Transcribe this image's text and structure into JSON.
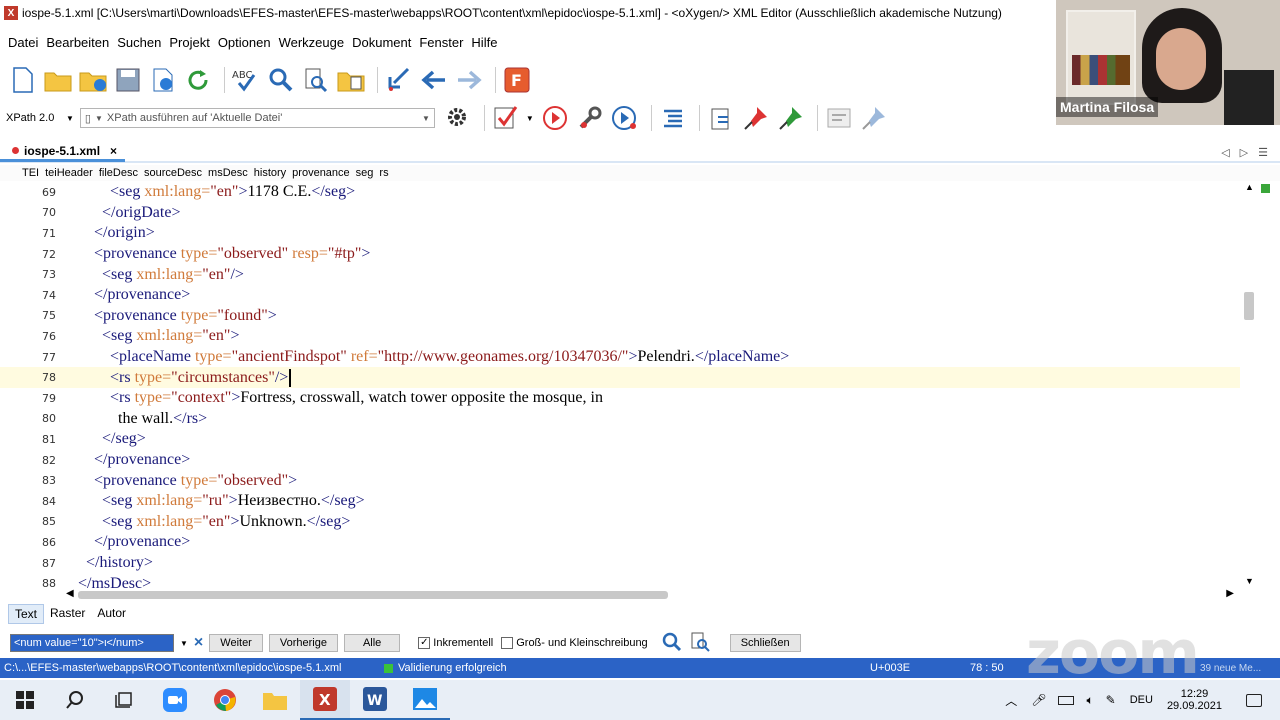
{
  "window": {
    "title": "iospe-5.1.xml [C:\\Users\\marti\\Downloads\\EFES-master\\EFES-master\\webapps\\ROOT\\content\\xml\\epidoc\\iospe-5.1.xml] - <oXygen/> XML Editor (Ausschließlich akademische Nutzung)"
  },
  "menu": [
    "Datei",
    "Bearbeiten",
    "Suchen",
    "Projekt",
    "Optionen",
    "Werkzeuge",
    "Dokument",
    "Fenster",
    "Hilfe"
  ],
  "toolbar2": {
    "xpath_version": "XPath 2.0",
    "xpath_placeholder": "XPath ausführen auf 'Aktuelle Datei'"
  },
  "file_tab": {
    "label": "iospe-5.1.xml"
  },
  "breadcrumb": [
    "TEI",
    "teiHeader",
    "fileDesc",
    "sourceDesc",
    "msDesc",
    "history",
    "provenance",
    "seg",
    "rs"
  ],
  "code_lines": [
    {
      "n": "69",
      "indent": "            ",
      "parts": [
        [
          "tag",
          "<seg "
        ],
        [
          "att",
          "xml:lang="
        ],
        [
          "val",
          "\"en\""
        ],
        [
          "tag",
          ">"
        ],
        [
          "txt",
          "1178 C.E."
        ],
        [
          "tag",
          "</seg>"
        ]
      ]
    },
    {
      "n": "70",
      "indent": "          ",
      "parts": [
        [
          "tag",
          "</origDate>"
        ]
      ]
    },
    {
      "n": "71",
      "indent": "        ",
      "parts": [
        [
          "tag",
          "</origin>"
        ]
      ]
    },
    {
      "n": "72",
      "indent": "        ",
      "parts": [
        [
          "tag",
          "<provenance "
        ],
        [
          "att",
          "type="
        ],
        [
          "val",
          "\"observed\" "
        ],
        [
          "att",
          "resp="
        ],
        [
          "val",
          "\"#tp\""
        ],
        [
          "tag",
          ">"
        ]
      ]
    },
    {
      "n": "73",
      "indent": "          ",
      "parts": [
        [
          "tag",
          "<seg "
        ],
        [
          "att",
          "xml:lang="
        ],
        [
          "val",
          "\"en\""
        ],
        [
          "tag",
          "/>"
        ]
      ]
    },
    {
      "n": "74",
      "indent": "        ",
      "parts": [
        [
          "tag",
          "</provenance>"
        ]
      ]
    },
    {
      "n": "75",
      "indent": "        ",
      "parts": [
        [
          "tag",
          "<provenance "
        ],
        [
          "att",
          "type="
        ],
        [
          "val",
          "\"found\""
        ],
        [
          "tag",
          ">"
        ]
      ]
    },
    {
      "n": "76",
      "indent": "          ",
      "parts": [
        [
          "tag",
          "<seg "
        ],
        [
          "att",
          "xml:lang="
        ],
        [
          "val",
          "\"en\""
        ],
        [
          "tag",
          ">"
        ]
      ]
    },
    {
      "n": "77",
      "indent": "            ",
      "parts": [
        [
          "tag",
          "<placeName "
        ],
        [
          "att",
          "type="
        ],
        [
          "val",
          "\"ancientFindspot\" "
        ],
        [
          "att",
          "ref="
        ],
        [
          "val",
          "\"http://www.geonames.org/10347036/\""
        ],
        [
          "tag",
          ">"
        ],
        [
          "txt",
          "Pelendri."
        ],
        [
          "tag",
          "</placeName>"
        ]
      ]
    },
    {
      "n": "78",
      "indent": "            ",
      "parts": [
        [
          "tag",
          "<rs "
        ],
        [
          "att",
          "type="
        ],
        [
          "val",
          "\"circumstances\""
        ],
        [
          "tag",
          "/>"
        ]
      ]
    },
    {
      "n": "79",
      "indent": "            ",
      "parts": [
        [
          "tag",
          "<rs "
        ],
        [
          "att",
          "type="
        ],
        [
          "val",
          "\"context\""
        ],
        [
          "tag",
          ">"
        ],
        [
          "txt",
          "Fortress, crosswall, watch tower opposite the mosque, in"
        ]
      ]
    },
    {
      "n": "80",
      "indent": "              ",
      "parts": [
        [
          "txt",
          "the wall."
        ],
        [
          "tag",
          "</rs>"
        ]
      ]
    },
    {
      "n": "81",
      "indent": "          ",
      "parts": [
        [
          "tag",
          "</seg>"
        ]
      ]
    },
    {
      "n": "82",
      "indent": "        ",
      "parts": [
        [
          "tag",
          "</provenance>"
        ]
      ]
    },
    {
      "n": "83",
      "indent": "        ",
      "parts": [
        [
          "tag",
          "<provenance "
        ],
        [
          "att",
          "type="
        ],
        [
          "val",
          "\"observed\""
        ],
        [
          "tag",
          ">"
        ]
      ]
    },
    {
      "n": "84",
      "indent": "          ",
      "parts": [
        [
          "tag",
          "<seg "
        ],
        [
          "att",
          "xml:lang="
        ],
        [
          "val",
          "\"ru\""
        ],
        [
          "tag",
          ">"
        ],
        [
          "txt",
          "Неизвестно."
        ],
        [
          "tag",
          "</seg>"
        ]
      ]
    },
    {
      "n": "85",
      "indent": "          ",
      "parts": [
        [
          "tag",
          "<seg "
        ],
        [
          "att",
          "xml:lang="
        ],
        [
          "val",
          "\"en\""
        ],
        [
          "tag",
          ">"
        ],
        [
          "txt",
          "Unknown."
        ],
        [
          "tag",
          "</seg>"
        ]
      ]
    },
    {
      "n": "86",
      "indent": "        ",
      "parts": [
        [
          "tag",
          "</provenance>"
        ]
      ]
    },
    {
      "n": "87",
      "indent": "      ",
      "parts": [
        [
          "tag",
          "</history>"
        ]
      ]
    },
    {
      "n": "88",
      "indent": "    ",
      "parts": [
        [
          "tag",
          "</msDesc>"
        ]
      ]
    }
  ],
  "current_line": "78",
  "mode_tabs": {
    "text": "Text",
    "grid": "Raster",
    "author": "Autor"
  },
  "find": {
    "value": "<num value=\"10\">ι</num>",
    "next": "Weiter",
    "prev": "Vorherige",
    "all": "Alle",
    "incremental": "Inkrementell",
    "case": "Groß- und Kleinschreibung",
    "close": "Schließen"
  },
  "status": {
    "path": "C:\\...\\EFES-master\\webapps\\ROOT\\content\\xml\\epidoc\\iospe-5.1.xml",
    "validation": "Validierung erfolgreich",
    "unicode": "U+003E",
    "position": "78 : 50",
    "notification": "39 neue Me..."
  },
  "taskbar": {
    "lang": "DEU",
    "time": "12:29",
    "date": "29.09.2021"
  },
  "webcam": {
    "name": "Martina Filosa"
  },
  "zoom_watermark": "zoom",
  "colors": {
    "tag": "#1a1a7a",
    "attribute": "#d07a3a",
    "value": "#8b1a1a",
    "status_bar": "#2b63c6"
  }
}
